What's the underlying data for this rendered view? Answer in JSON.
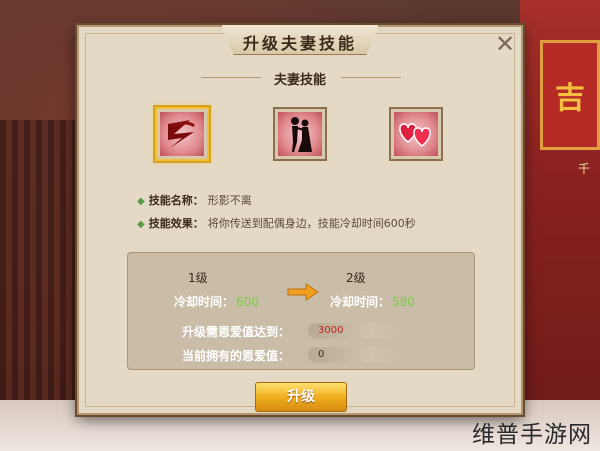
{
  "background": {
    "banner_char": "吉",
    "side_text": "千"
  },
  "watermark": "维普手游网",
  "dialog": {
    "title": "升级夫妻技能",
    "close_icon": "close-icon",
    "section_title": "夫妻技能",
    "skills": [
      {
        "icon": "lightning-swirl-icon",
        "selected": true
      },
      {
        "icon": "couple-dancing-icon",
        "selected": false
      },
      {
        "icon": "double-hearts-icon",
        "selected": false
      }
    ],
    "info": {
      "name_label": "技能名称：",
      "name_value": "形影不离",
      "effect_label": "技能效果：",
      "effect_value": "将你传送到配偶身边，技能冷却时间600秒"
    },
    "upgrade_box": {
      "current_level": "1级",
      "next_level": "2级",
      "cooldown_label": "冷却时间：",
      "current_cooldown": "600",
      "next_cooldown": "580",
      "required_label": "升级需恩爱值达到：",
      "required_value": "3000",
      "owned_label": "当前拥有的恩爱值：",
      "owned_value": "0"
    },
    "upgrade_button": "升级"
  },
  "colors": {
    "panel": "#e4d9c4",
    "green_value": "#7ad040",
    "required_red": "#c02020",
    "button_gold": "#f0b020"
  }
}
